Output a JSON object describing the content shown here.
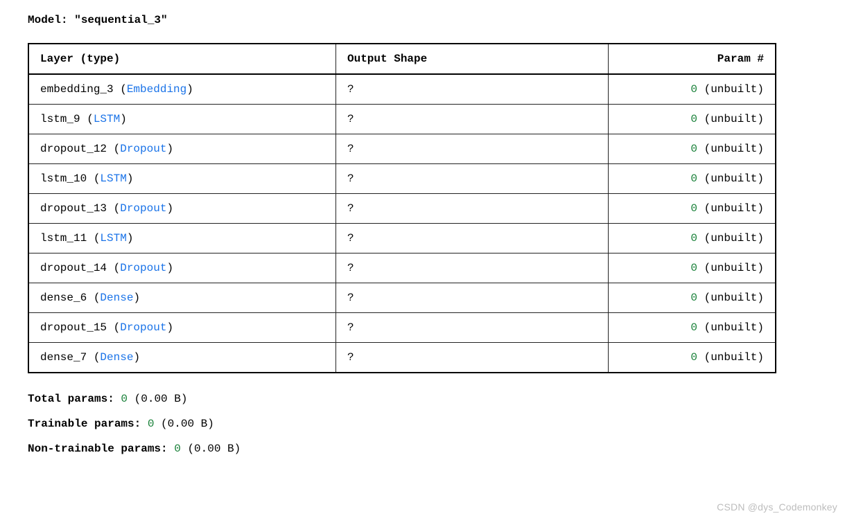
{
  "model_label": "Model: \"sequential_3\"",
  "headers": {
    "layer": "Layer (type)",
    "output": "Output Shape",
    "param": "Param #"
  },
  "rows": [
    {
      "name": "embedding_3",
      "type": "Embedding",
      "output": "?",
      "param_zero": "0",
      "unbuilt": "(unbuilt)"
    },
    {
      "name": "lstm_9",
      "type": "LSTM",
      "output": "?",
      "param_zero": "0",
      "unbuilt": "(unbuilt)"
    },
    {
      "name": "dropout_12",
      "type": "Dropout",
      "output": "?",
      "param_zero": "0",
      "unbuilt": "(unbuilt)"
    },
    {
      "name": "lstm_10",
      "type": "LSTM",
      "output": "?",
      "param_zero": "0",
      "unbuilt": "(unbuilt)"
    },
    {
      "name": "dropout_13",
      "type": "Dropout",
      "output": "?",
      "param_zero": "0",
      "unbuilt": "(unbuilt)"
    },
    {
      "name": "lstm_11",
      "type": "LSTM",
      "output": "?",
      "param_zero": "0",
      "unbuilt": "(unbuilt)"
    },
    {
      "name": "dropout_14",
      "type": "Dropout",
      "output": "?",
      "param_zero": "0",
      "unbuilt": "(unbuilt)"
    },
    {
      "name": "dense_6",
      "type": "Dense",
      "output": "?",
      "param_zero": "0",
      "unbuilt": "(unbuilt)"
    },
    {
      "name": "dropout_15",
      "type": "Dropout",
      "output": "?",
      "param_zero": "0",
      "unbuilt": "(unbuilt)"
    },
    {
      "name": "dense_7",
      "type": "Dense",
      "output": "?",
      "param_zero": "0",
      "unbuilt": "(unbuilt)"
    }
  ],
  "totals": {
    "total_label": "Total params: ",
    "total_zero": "0",
    "total_suffix": " (0.00 B)",
    "trainable_label": "Trainable params: ",
    "trainable_zero": "0",
    "trainable_suffix": " (0.00 B)",
    "nontrainable_label": "Non-trainable params: ",
    "nontrainable_zero": "0",
    "nontrainable_suffix": " (0.00 B)"
  },
  "watermark": "CSDN @dys_Codemonkey"
}
